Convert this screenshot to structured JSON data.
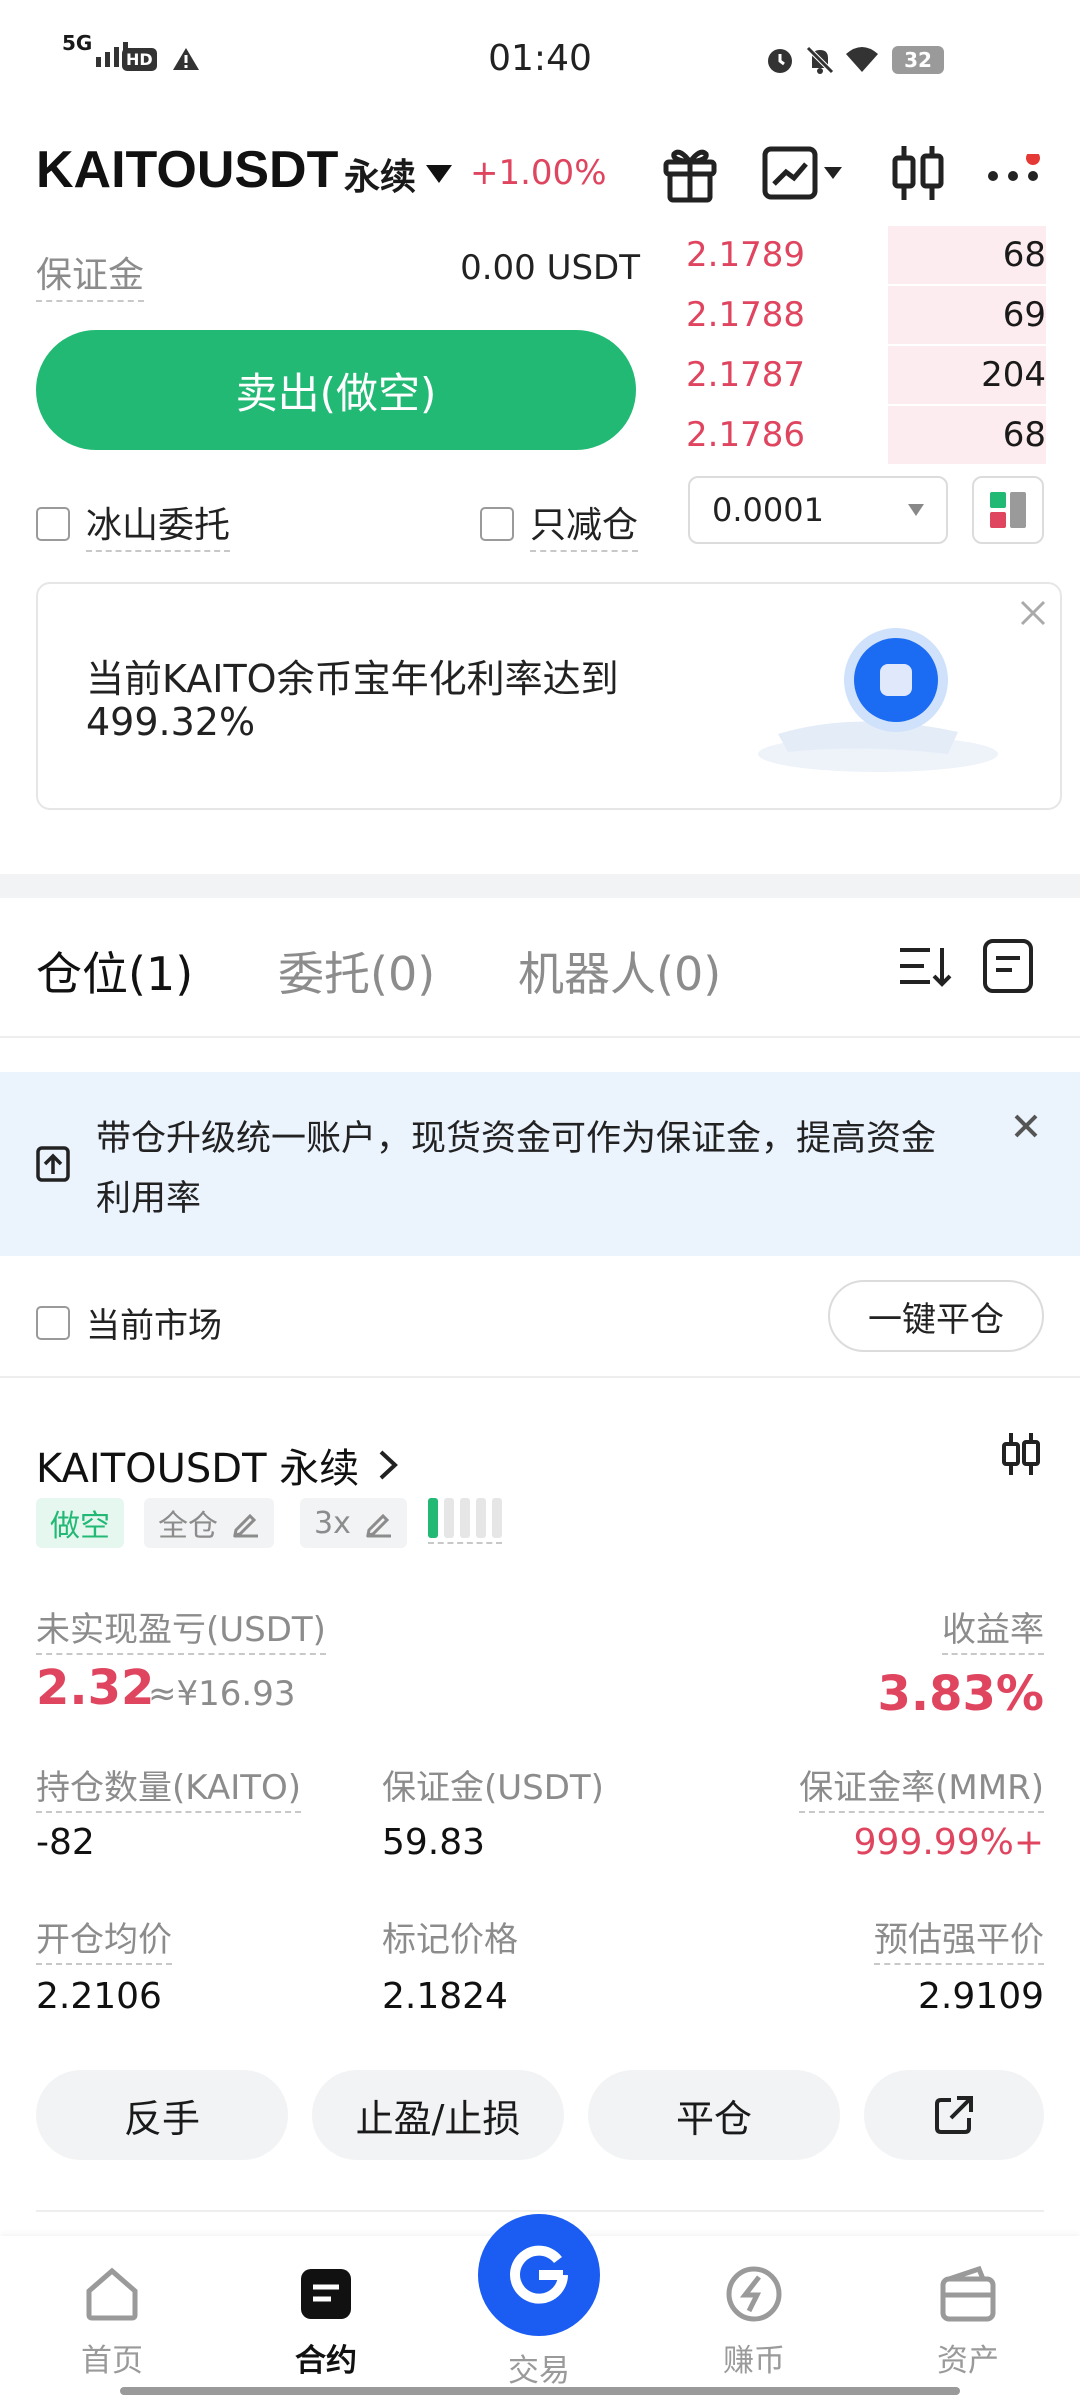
{
  "status_bar": {
    "network": "5G",
    "hd": "HD",
    "time": "01:40",
    "battery": "32"
  },
  "header": {
    "symbol": "KAITOUSDT",
    "contract_type": "永续",
    "change": "+1.00%"
  },
  "order_form": {
    "margin_label": "保证金",
    "margin_value": "0.00 USDT",
    "sell_button": "卖出(做空)",
    "iceberg_label": "冰山委托",
    "reduce_only_label": "只减仓"
  },
  "order_book": {
    "asks": [
      {
        "price": "2.1789",
        "qty": "68",
        "depth": 0.44
      },
      {
        "price": "2.1788",
        "qty": "69",
        "depth": 0.44
      },
      {
        "price": "2.1787",
        "qty": "204",
        "depth": 0.44
      },
      {
        "price": "2.1786",
        "qty": "68",
        "depth": 0.44
      }
    ],
    "precision": "0.0001"
  },
  "promo": {
    "line1": "当前KAITO余币宝年化利率达到",
    "line2": "499.32%"
  },
  "tabs": {
    "positions": "仓位(1)",
    "orders": "委托(0)",
    "bots": "机器人(0)"
  },
  "notice": {
    "line1": "带仓升级统一账户，现货资金可作为保证金，提高资金",
    "line2": "利用率"
  },
  "filter": {
    "current_market": "当前市场",
    "close_all": "一键平仓"
  },
  "position": {
    "symbol": "KAITOUSDT 永续",
    "side": "做空",
    "margin_mode": "全仓",
    "leverage": "3x",
    "pnl_label": "未实现盈亏(USDT)",
    "pnl_value": "2.32",
    "pnl_cny": "≈¥16.93",
    "roe_label": "收益率",
    "roe_value": "3.83%",
    "size_label": "持仓数量(KAITO)",
    "size_value": "-82",
    "margin_label": "保证金(USDT)",
    "margin_value": "59.83",
    "mmr_label": "保证金率(MMR)",
    "mmr_value": "999.99%+",
    "entry_label": "开仓均价",
    "entry_value": "2.2106",
    "mark_label": "标记价格",
    "mark_value": "2.1824",
    "liq_label": "预估强平价",
    "liq_value": "2.9109",
    "btn_reverse": "反手",
    "btn_tpsl": "止盈/止损",
    "btn_close": "平仓"
  },
  "bottom_nav": {
    "home": "首页",
    "futures": "合约",
    "trade": "交易",
    "earn": "赚币",
    "assets": "资产"
  }
}
